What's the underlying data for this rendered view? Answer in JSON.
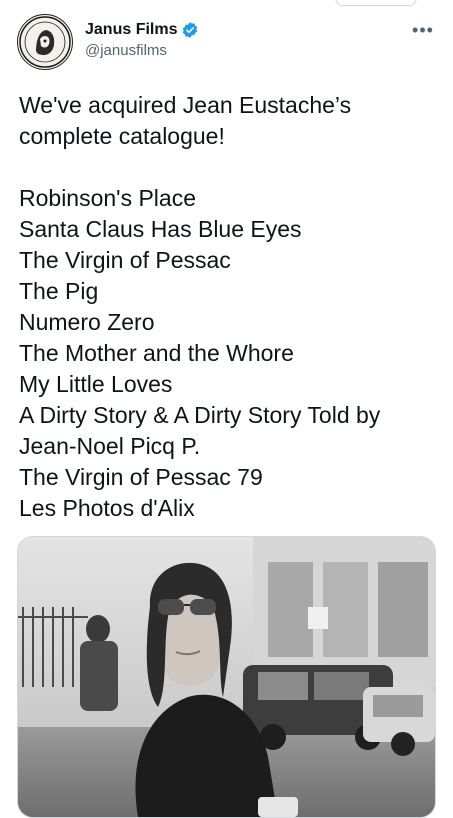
{
  "tweet": {
    "author": {
      "display_name": "Janus Films",
      "handle": "@janusfilms",
      "verified": true,
      "avatar_icon": "janus-logo-avatar"
    },
    "more_icon": "more-options-icon",
    "headline": "We've acquired Jean Eustache’s complete catalogue!",
    "film_list": [
      "Robinson's Place",
      "Santa Claus Has Blue Eyes",
      "The Virgin of Pessac",
      "The Pig",
      "Numero Zero",
      "The Mother and the Whore",
      "My Little Loves",
      "A Dirty Story & A Dirty Story Told by",
      "Jean-Noel Picq P.",
      "The Virgin of Pessac 79",
      "Les Photos d'Alix"
    ],
    "media": {
      "kind": "photo"
    }
  },
  "colors": {
    "text_primary": "#0f1419",
    "text_secondary": "#536471",
    "verified_blue": "#1d9bf0",
    "border": "#cfd9de"
  }
}
